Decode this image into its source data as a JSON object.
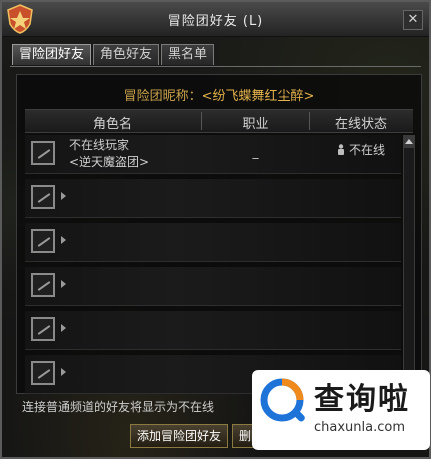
{
  "window": {
    "title": "冒险团好友 (L)",
    "close_label": "✕"
  },
  "tabs": [
    {
      "label": "冒险团好友",
      "active": true
    },
    {
      "label": "角色好友",
      "active": false
    },
    {
      "label": "黑名单",
      "active": false
    }
  ],
  "nickname": {
    "label": "冒险团昵称：",
    "value": "<纷飞蝶舞红尘醉>"
  },
  "columns": {
    "name": "角色名",
    "job": "职业",
    "status": "在线状态"
  },
  "rows": [
    {
      "name": "不在线玩家",
      "guild": "<逆天魔盗团>",
      "job": "_",
      "status": "不在线"
    },
    {
      "name": "",
      "guild": "",
      "job": "",
      "status": ""
    },
    {
      "name": "",
      "guild": "",
      "job": "",
      "status": ""
    },
    {
      "name": "",
      "guild": "",
      "job": "",
      "status": ""
    },
    {
      "name": "",
      "guild": "",
      "job": "",
      "status": ""
    },
    {
      "name": "",
      "guild": "",
      "job": "",
      "status": ""
    }
  ],
  "footer": {
    "note": "连接普通频道的好友将显示为不在线"
  },
  "buttons": {
    "add": "添加冒险团好友",
    "delete": "删除冒险团好友"
  },
  "watermark": {
    "title": "查询啦",
    "url": "chaxunla.com"
  },
  "colors": {
    "accent_gold": "#e3b24b",
    "window_bg": "#141414"
  }
}
